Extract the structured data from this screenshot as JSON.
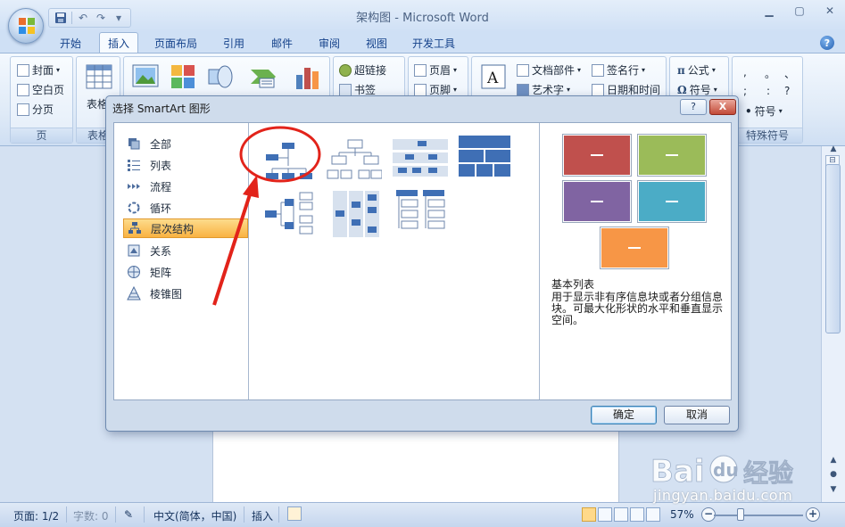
{
  "window": {
    "title": "架构图 - Microsoft Word"
  },
  "quick_access": {
    "icons": [
      "save-icon",
      "undo-icon",
      "redo-icon",
      "customize-icon"
    ]
  },
  "tabs": [
    {
      "label": "开始"
    },
    {
      "label": "插入",
      "active": true
    },
    {
      "label": "页面布局"
    },
    {
      "label": "引用"
    },
    {
      "label": "邮件"
    },
    {
      "label": "审阅"
    },
    {
      "label": "视图"
    },
    {
      "label": "开发工具"
    }
  ],
  "ribbon": {
    "pages_group": {
      "label": "页",
      "items": [
        "封面",
        "空白页",
        "分页"
      ]
    },
    "table_group": {
      "label": "表格",
      "button": "表格"
    },
    "links_group": {
      "items": [
        "超链接",
        "书签"
      ]
    },
    "header_group": {
      "items": [
        "页眉",
        "页脚"
      ]
    },
    "text_group": {
      "items": [
        "文档部件",
        "签名行",
        "艺术字",
        "日期和时间"
      ]
    },
    "symbols_group": {
      "label": "特殊符号",
      "items": [
        "公式",
        "符号",
        "符号"
      ],
      "punct": [
        ",",
        "。",
        "、",
        ";",
        ":",
        "?"
      ]
    }
  },
  "dialog": {
    "title": "选择 SmartArt 图形",
    "help_label": "?",
    "close_label": "X",
    "categories": [
      {
        "label": "全部",
        "icon": "all-icon"
      },
      {
        "label": "列表",
        "icon": "list-icon"
      },
      {
        "label": "流程",
        "icon": "process-icon"
      },
      {
        "label": "循环",
        "icon": "cycle-icon"
      },
      {
        "label": "层次结构",
        "icon": "hierarchy-icon",
        "selected": true
      },
      {
        "label": "关系",
        "icon": "relationship-icon"
      },
      {
        "label": "矩阵",
        "icon": "matrix-icon"
      },
      {
        "label": "棱锥图",
        "icon": "pyramid-icon"
      }
    ],
    "preview": {
      "title": "基本列表",
      "description": "用于显示非有序信息块或者分组信息块。可最大化形状的水平和垂直显示空间。",
      "colors": [
        "#c0504d",
        "#9bbb59",
        "#8064a2",
        "#4bacc6",
        "#f79646"
      ]
    },
    "ok_label": "确定",
    "cancel_label": "取消"
  },
  "statusbar": {
    "page": "页面: 1/2",
    "words": "字数: 0",
    "language": "中文(简体，中国)",
    "mode": "插入",
    "zoom": "57%",
    "zoom_minus": "−",
    "zoom_plus": "+"
  },
  "watermark": {
    "site": "jingyan.baidu.com"
  }
}
